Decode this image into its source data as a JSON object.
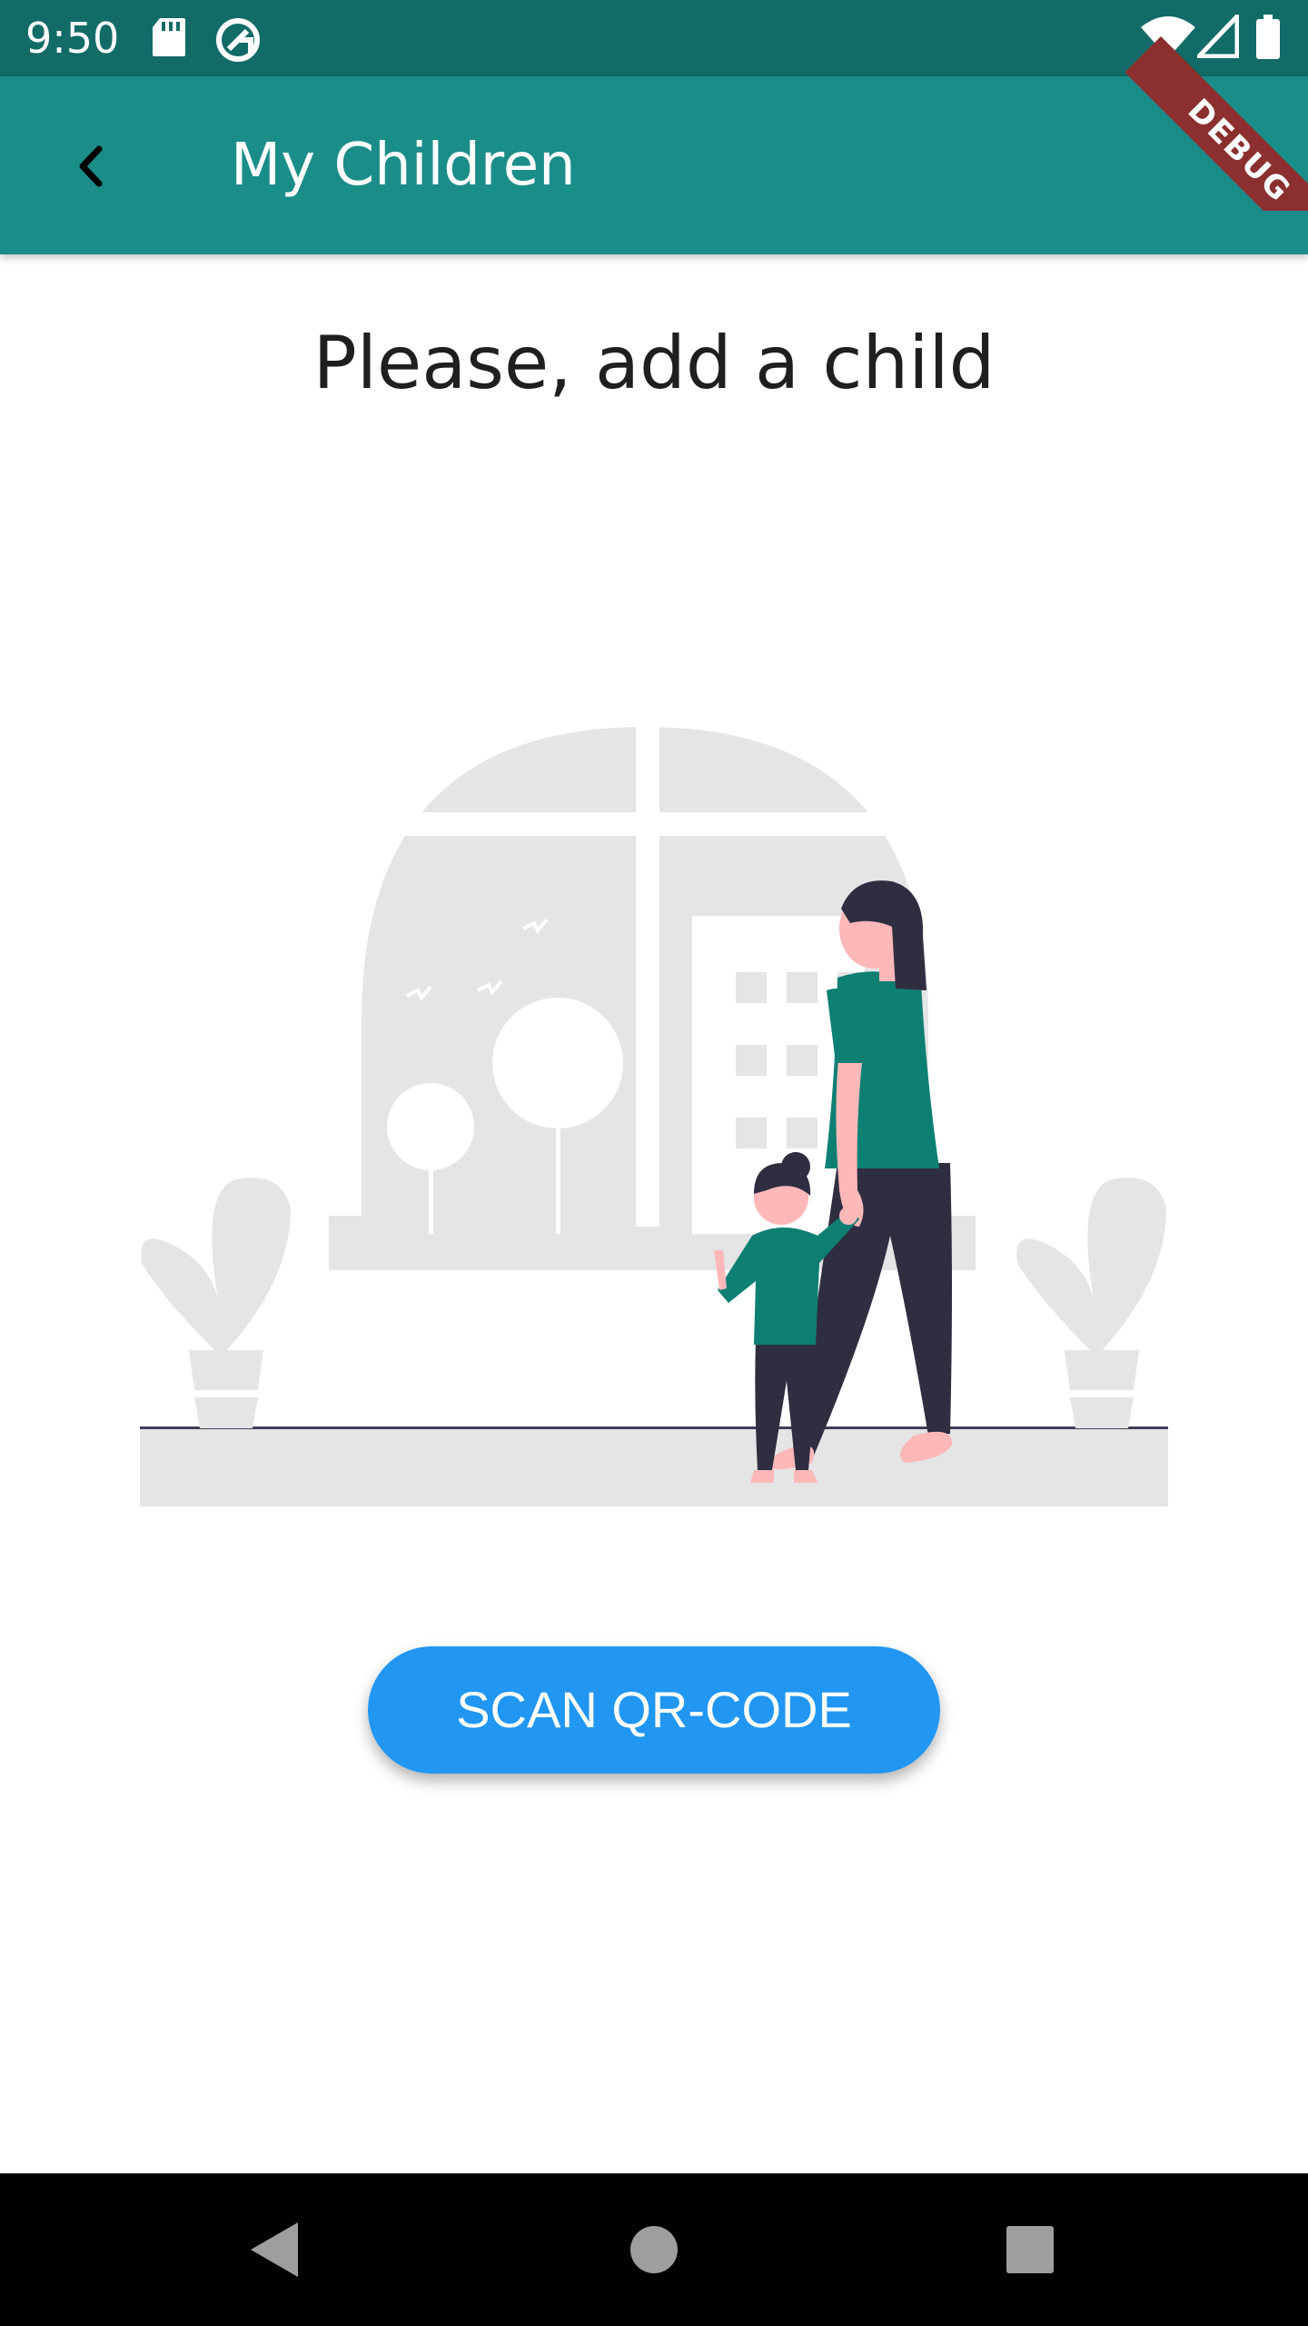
{
  "status_bar": {
    "time": "9:50",
    "icons": [
      "sd-card-icon",
      "sync-icon",
      "wifi-icon",
      "cell-signal-icon",
      "battery-icon"
    ]
  },
  "debug_banner": {
    "label": "DEBUG"
  },
  "app_bar": {
    "title": "My Children",
    "back_icon": "chevron-left-icon",
    "background": "#1b8d89"
  },
  "main": {
    "heading": "Please, add a child",
    "illustration": "mother-and-child-at-window",
    "scan_button_label": "SCAN QR-CODE",
    "scan_button_color": "#2196f3"
  },
  "nav_bar": {
    "buttons": [
      "back-triangle-icon",
      "home-circle-icon",
      "recents-square-icon"
    ]
  },
  "colors": {
    "status_bar": "#136b68",
    "accent_teal": "#0e7f73",
    "illustration_gray": "#e5e5e5"
  }
}
